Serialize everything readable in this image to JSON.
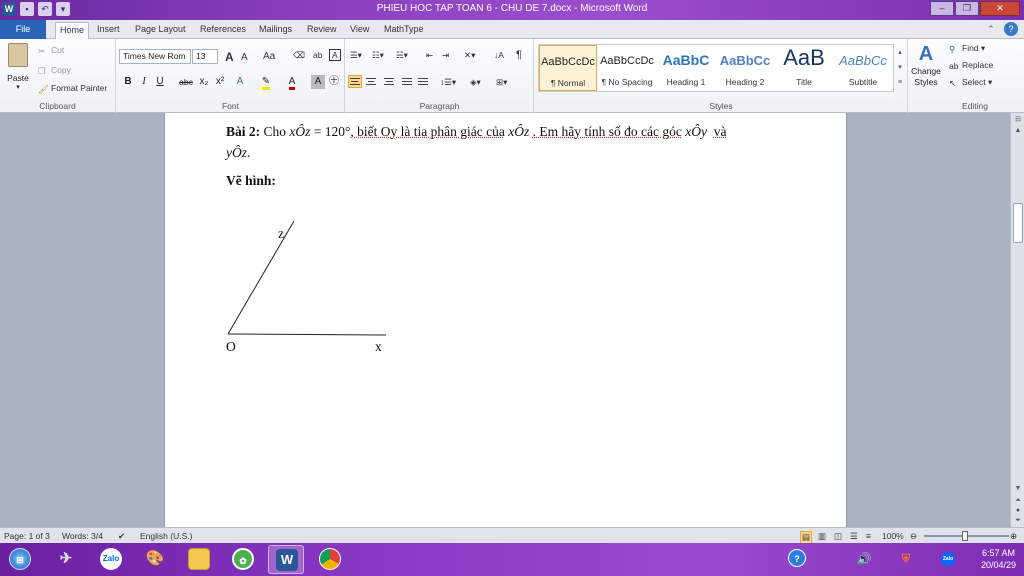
{
  "window": {
    "title": "PHIEU HOC TAP TOAN 6 - CHU DE 7.docx - Microsoft Word",
    "minimize": "–",
    "restore": "❐",
    "close": "✕"
  },
  "tabs": [
    "File",
    "Home",
    "Insert",
    "Page Layout",
    "References",
    "Mailings",
    "Review",
    "View",
    "MathType"
  ],
  "clipboard": {
    "paste": "Paste",
    "cut": "Cut",
    "copy": "Copy",
    "format_painter": "Format Painter",
    "label": "Clipboard"
  },
  "font": {
    "family": "Times New Rom",
    "size": "13",
    "bold": "B",
    "italic": "I",
    "underline": "U",
    "strike": "abc",
    "subscript": "x₂",
    "superscript": "x²",
    "grow": "A",
    "shrink": "A",
    "case": "Aa",
    "label": "Font"
  },
  "paragraph": {
    "label": "Paragraph",
    "pilcrow": "¶"
  },
  "styles": {
    "label": "Styles",
    "items": [
      {
        "preview": "AaBbCcDc",
        "name": "¶ Normal",
        "color": "#000000"
      },
      {
        "preview": "AaBbCcDc",
        "name": "¶ No Spacing",
        "color": "#000000"
      },
      {
        "preview": "AaBbC",
        "name": "Heading 1",
        "color": "#2e74b5"
      },
      {
        "preview": "AaBbCc",
        "name": "Heading 2",
        "color": "#4f81bd"
      },
      {
        "preview": "AaB",
        "name": "Title",
        "color": "#17365d"
      },
      {
        "preview": "AaBbCc",
        "name": "Subtitle",
        "color": "#4f81bd"
      }
    ],
    "change_styles": "Change Styles"
  },
  "editing": {
    "find": "Find",
    "replace": "Replace",
    "select": "Select",
    "label": "Editing"
  },
  "document": {
    "problem_title": "Bài 2:",
    "line1_a": "Cho",
    "angle_xoz": "xÔz",
    "equals": "= 120°",
    "line1_b": ", biết Oy là tia phân giác của",
    "line1_c": ". Em hãy tính số đo các góc",
    "angle_xoy": "xÔy",
    "and": "và",
    "angle_yoz": "yÔz",
    "period": ".",
    "draw_label": "Vẽ hình:",
    "figure": {
      "label_z": "z",
      "label_o": "O",
      "label_x": "x"
    }
  },
  "status": {
    "page": "Page: 1 of 3",
    "words": "Words: 3/4",
    "language": "English (U.S.)",
    "zoom": "100%"
  },
  "taskbar": {
    "zalo": "Zalo",
    "word": "W",
    "time": "6:57 AM",
    "date": "20/04/29"
  }
}
